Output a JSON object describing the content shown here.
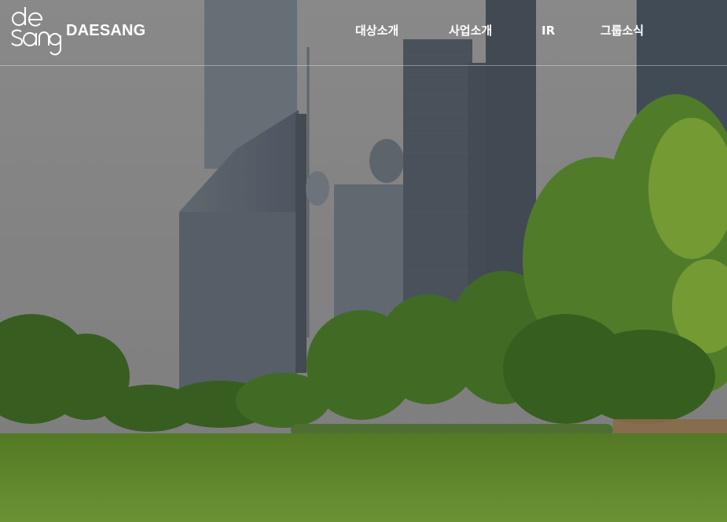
{
  "header": {
    "logo_text": "DAESANG",
    "logo_mark_name": "daesang-logo-mark",
    "nav": [
      {
        "label": "대상소개"
      },
      {
        "label": "사업소개"
      },
      {
        "label": "IR"
      },
      {
        "label": "그룹소식"
      }
    ]
  },
  "colors": {
    "nav_text": "#ffffff",
    "header_divider": "rgba(255,255,255,0.35)",
    "sky": "#9a9a9a",
    "grass": "#6f9a37",
    "tree": "#4f7d2a"
  }
}
